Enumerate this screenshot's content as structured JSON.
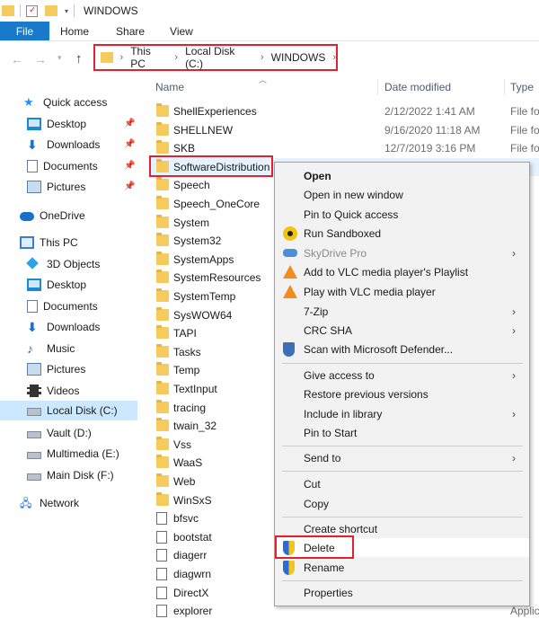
{
  "window": {
    "title": "WINDOWS"
  },
  "ribbon": {
    "tabs": [
      "File",
      "Home",
      "Share",
      "View"
    ]
  },
  "address": {
    "crumbs": [
      "This PC",
      "Local Disk (C:)",
      "WINDOWS"
    ]
  },
  "nav": {
    "quick_access": "Quick access",
    "qa_items": [
      "Desktop",
      "Downloads",
      "Documents",
      "Pictures"
    ],
    "onedrive": "OneDrive",
    "this_pc": "This PC",
    "pc_items": [
      "3D Objects",
      "Desktop",
      "Documents",
      "Downloads",
      "Music",
      "Pictures",
      "Videos",
      "Local Disk (C:)",
      "Vault (D:)",
      "Multimedia (E:)",
      "Main Disk (F:)"
    ],
    "network": "Network"
  },
  "columns": {
    "name": "Name",
    "date": "Date modified",
    "type": "Type"
  },
  "files": [
    {
      "name": "ShellExperiences",
      "date": "2/12/2022 1:41 AM",
      "type": "File fo"
    },
    {
      "name": "SHELLNEW",
      "date": "9/16/2020 11:18 AM",
      "type": "File fo"
    },
    {
      "name": "SKB",
      "date": "12/7/2019 3:16 PM",
      "type": "File fo"
    },
    {
      "name": "SoftwareDistribution",
      "date": "",
      "type": ""
    },
    {
      "name": "Speech",
      "date": "",
      "type": ""
    },
    {
      "name": "Speech_OneCore",
      "date": "",
      "type": ""
    },
    {
      "name": "System",
      "date": "",
      "type": ""
    },
    {
      "name": "System32",
      "date": "",
      "type": ""
    },
    {
      "name": "SystemApps",
      "date": "",
      "type": ""
    },
    {
      "name": "SystemResources",
      "date": "",
      "type": ""
    },
    {
      "name": "SystemTemp",
      "date": "",
      "type": ""
    },
    {
      "name": "SysWOW64",
      "date": "",
      "type": ""
    },
    {
      "name": "TAPI",
      "date": "",
      "type": ""
    },
    {
      "name": "Tasks",
      "date": "",
      "type": ""
    },
    {
      "name": "Temp",
      "date": "",
      "type": ""
    },
    {
      "name": "TextInput",
      "date": "",
      "type": ""
    },
    {
      "name": "tracing",
      "date": "",
      "type": ""
    },
    {
      "name": "twain_32",
      "date": "",
      "type": ""
    },
    {
      "name": "Vss",
      "date": "",
      "type": ""
    },
    {
      "name": "WaaS",
      "date": "",
      "type": ""
    },
    {
      "name": "Web",
      "date": "",
      "type": ""
    },
    {
      "name": "WinSxS",
      "date": "",
      "type": ""
    },
    {
      "name": "bfsvc",
      "date": "",
      "type": ""
    },
    {
      "name": "bootstat",
      "date": "",
      "type": ""
    },
    {
      "name": "diagerr",
      "date": "",
      "type": ""
    },
    {
      "name": "diagwrn",
      "date": "",
      "type": ""
    },
    {
      "name": "DirectX",
      "date": "",
      "type": ""
    },
    {
      "name": "explorer",
      "date": "",
      "type": "Applic"
    }
  ],
  "menu": {
    "open": "Open",
    "open_new_window": "Open in new window",
    "pin_quick_access": "Pin to Quick access",
    "run_sandboxed": "Run Sandboxed",
    "skydrive_pro": "SkyDrive Pro",
    "vlc_playlist": "Add to VLC media player's Playlist",
    "vlc_play": "Play with VLC media player",
    "seven_zip": "7-Zip",
    "crc_sha": "CRC SHA",
    "scan_defender": "Scan with Microsoft Defender...",
    "give_access": "Give access to",
    "restore_versions": "Restore previous versions",
    "include_library": "Include in library",
    "pin_start": "Pin to Start",
    "send_to": "Send to",
    "cut": "Cut",
    "copy": "Copy",
    "create_shortcut": "Create shortcut",
    "delete": "Delete",
    "rename": "Rename",
    "properties": "Properties"
  },
  "colors": {
    "accent": "#1979ca",
    "annotation": "#e5202e",
    "selection": "#cce8ff"
  }
}
